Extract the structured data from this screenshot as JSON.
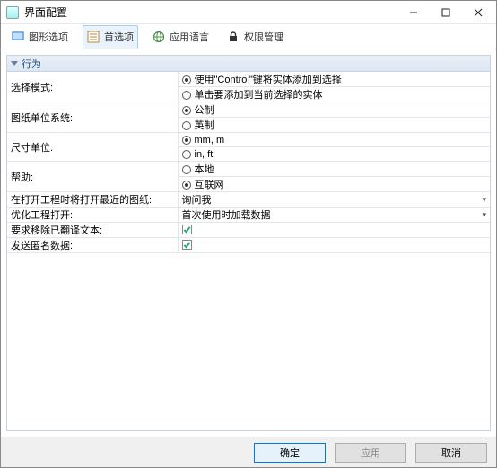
{
  "window": {
    "title": "界面配置"
  },
  "tabs": [
    {
      "label": "图形选项"
    },
    {
      "label": "首选项"
    },
    {
      "label": "应用语言"
    },
    {
      "label": "权限管理"
    }
  ],
  "section": {
    "title": "行为"
  },
  "rows": {
    "select_mode": {
      "label": "选择模式:",
      "opt1": "使用\"Control\"键将实体添加到选择",
      "opt2": "单击要添加到当前选择的实体"
    },
    "unit_system": {
      "label": "图纸单位系统:",
      "opt1": "公制",
      "opt2": "英制"
    },
    "size_unit": {
      "label": "尺寸单位:",
      "opt1": "mm, m",
      "opt2": "in, ft"
    },
    "help": {
      "label": "帮助:",
      "opt1": "本地",
      "opt2": "互联网"
    },
    "recent_drawing": {
      "label": "在打开工程时将打开最近的图纸:",
      "value": "询问我"
    },
    "optimize_open": {
      "label": "优化工程打开:",
      "value": "首次使用时加载数据"
    },
    "remove_translated": {
      "label": "要求移除已翻译文本:"
    },
    "send_anon": {
      "label": "发送匿名数据:"
    }
  },
  "buttons": {
    "ok": "确定",
    "apply": "应用",
    "cancel": "取消"
  }
}
